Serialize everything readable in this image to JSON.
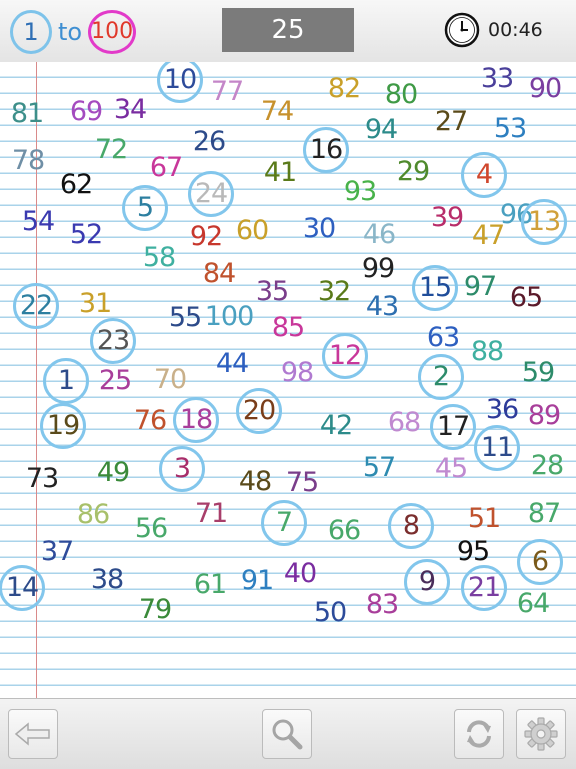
{
  "header": {
    "title_start": "1",
    "title_to": "to",
    "title_end": "100",
    "counter": "25",
    "timer": "00:46"
  },
  "icons": {
    "back": "back-arrow-icon",
    "zoom": "magnifier-icon",
    "refresh": "refresh-icon",
    "settings": "gear-icon",
    "clock": "clock-icon"
  },
  "colors": {
    "found_circle": "#82c6ec",
    "counter_bg": "#7b7b7b"
  },
  "numbers": [
    {
      "v": "10",
      "c": "#2d4b9a",
      "found": true
    },
    {
      "v": "77",
      "c": "#c486c8",
      "found": false
    },
    {
      "v": "82",
      "c": "#c9a02a",
      "found": false
    },
    {
      "v": "80",
      "c": "#3f9a46",
      "found": false
    },
    {
      "v": "33",
      "c": "#4a3f9a",
      "found": false
    },
    {
      "v": "90",
      "c": "#7a3ea0",
      "found": false
    },
    {
      "v": "81",
      "c": "#3d8f8a",
      "found": false
    },
    {
      "v": "69",
      "c": "#a44bbf",
      "found": false
    },
    {
      "v": "34",
      "c": "#7a2da0",
      "found": false
    },
    {
      "v": "74",
      "c": "#c7912d",
      "found": false
    },
    {
      "v": "94",
      "c": "#2c8b8a",
      "found": false
    },
    {
      "v": "27",
      "c": "#5a4a1a",
      "found": false
    },
    {
      "v": "53",
      "c": "#2d7fc0",
      "found": false
    },
    {
      "v": "78",
      "c": "#6f8fa6",
      "found": false
    },
    {
      "v": "72",
      "c": "#48a86a",
      "found": false
    },
    {
      "v": "26",
      "c": "#2d4b8a",
      "found": false
    },
    {
      "v": "16",
      "c": "#222222",
      "found": true
    },
    {
      "v": "67",
      "c": "#c8379a",
      "found": false
    },
    {
      "v": "41",
      "c": "#5a7a1a",
      "found": false
    },
    {
      "v": "29",
      "c": "#4f8a2d",
      "found": false
    },
    {
      "v": "4",
      "c": "#d0472d",
      "found": true
    },
    {
      "v": "62",
      "c": "#111111",
      "found": false
    },
    {
      "v": "93",
      "c": "#48b24a",
      "found": false
    },
    {
      "v": "5",
      "c": "#2d7fa0",
      "found": true
    },
    {
      "v": "24",
      "c": "#b9b9b9",
      "found": true
    },
    {
      "v": "54",
      "c": "#3a3ab0",
      "found": false
    },
    {
      "v": "52",
      "c": "#3a3ab0",
      "found": false
    },
    {
      "v": "92",
      "c": "#c7382d",
      "found": false
    },
    {
      "v": "60",
      "c": "#c9a02a",
      "found": false
    },
    {
      "v": "30",
      "c": "#2d5fc0",
      "found": false
    },
    {
      "v": "46",
      "c": "#8ab6c8",
      "found": false
    },
    {
      "v": "39",
      "c": "#b82d6a",
      "found": false
    },
    {
      "v": "47",
      "c": "#c9a02a",
      "found": false
    },
    {
      "v": "96",
      "c": "#4aa0c0",
      "found": false
    },
    {
      "v": "13",
      "c": "#d0a03a",
      "found": true
    },
    {
      "v": "58",
      "c": "#3fb0a0",
      "found": false
    },
    {
      "v": "84",
      "c": "#c0522d",
      "found": false
    },
    {
      "v": "99",
      "c": "#222222",
      "found": false
    },
    {
      "v": "22",
      "c": "#2d7fa0",
      "found": true
    },
    {
      "v": "31",
      "c": "#c9a02a",
      "found": false
    },
    {
      "v": "35",
      "c": "#7a3e8a",
      "found": false
    },
    {
      "v": "32",
      "c": "#5a7a1a",
      "found": false
    },
    {
      "v": "43",
      "c": "#2d6fb0",
      "found": false
    },
    {
      "v": "15",
      "c": "#1f4d9a",
      "found": true
    },
    {
      "v": "97",
      "c": "#2d8b6a",
      "found": false
    },
    {
      "v": "65",
      "c": "#5a1a2a",
      "found": false
    },
    {
      "v": "55",
      "c": "#2d4b8a",
      "found": false
    },
    {
      "v": "100",
      "c": "#4aa0c0",
      "found": false
    },
    {
      "v": "85",
      "c": "#c8379a",
      "found": false
    },
    {
      "v": "23",
      "c": "#555555",
      "found": true
    },
    {
      "v": "63",
      "c": "#2d5fc0",
      "found": false
    },
    {
      "v": "88",
      "c": "#3fb0a0",
      "found": false
    },
    {
      "v": "44",
      "c": "#2d5fc0",
      "found": false
    },
    {
      "v": "98",
      "c": "#b07ad0",
      "found": false
    },
    {
      "v": "12",
      "c": "#c8379a",
      "found": true
    },
    {
      "v": "1",
      "c": "#2d4b8a",
      "found": true
    },
    {
      "v": "25",
      "c": "#a83e9a",
      "found": false
    },
    {
      "v": "70",
      "c": "#c9b08a",
      "found": false
    },
    {
      "v": "2",
      "c": "#2d8b6a",
      "found": true
    },
    {
      "v": "59",
      "c": "#2d8b6a",
      "found": false
    },
    {
      "v": "19",
      "c": "#5a4a1a",
      "found": true
    },
    {
      "v": "76",
      "c": "#c0522d",
      "found": false
    },
    {
      "v": "18",
      "c": "#a83e9a",
      "found": true
    },
    {
      "v": "20",
      "c": "#7a3e1a",
      "found": true
    },
    {
      "v": "42",
      "c": "#2d8b8a",
      "found": false
    },
    {
      "v": "68",
      "c": "#c08ad0",
      "found": false
    },
    {
      "v": "17",
      "c": "#222222",
      "found": true
    },
    {
      "v": "36",
      "c": "#2d3b9a",
      "found": false
    },
    {
      "v": "89",
      "c": "#a83e9a",
      "found": false
    },
    {
      "v": "11",
      "c": "#2d4b8a",
      "found": true
    },
    {
      "v": "73",
      "c": "#222222",
      "found": false
    },
    {
      "v": "49",
      "c": "#3a8a3a",
      "found": false
    },
    {
      "v": "3",
      "c": "#a82d6a",
      "found": true
    },
    {
      "v": "48",
      "c": "#5a4a1a",
      "found": false
    },
    {
      "v": "75",
      "c": "#7a3e8a",
      "found": false
    },
    {
      "v": "57",
      "c": "#2d8bb0",
      "found": false
    },
    {
      "v": "45",
      "c": "#c08ad0",
      "found": false
    },
    {
      "v": "28",
      "c": "#48a86a",
      "found": false
    },
    {
      "v": "86",
      "c": "#a8c06a",
      "found": false
    },
    {
      "v": "56",
      "c": "#48a86a",
      "found": false
    },
    {
      "v": "71",
      "c": "#a83e6a",
      "found": false
    },
    {
      "v": "7",
      "c": "#48a86a",
      "found": true
    },
    {
      "v": "66",
      "c": "#48a86a",
      "found": false
    },
    {
      "v": "8",
      "c": "#7a2d2d",
      "found": true
    },
    {
      "v": "51",
      "c": "#c0522d",
      "found": false
    },
    {
      "v": "87",
      "c": "#48a86a",
      "found": false
    },
    {
      "v": "37",
      "c": "#2d4b9a",
      "found": false
    },
    {
      "v": "95",
      "c": "#111111",
      "found": false
    },
    {
      "v": "6",
      "c": "#7a5a1a",
      "found": true
    },
    {
      "v": "14",
      "c": "#2d4b8a",
      "found": true
    },
    {
      "v": "38",
      "c": "#2d4b8a",
      "found": false
    },
    {
      "v": "61",
      "c": "#48a86a",
      "found": false
    },
    {
      "v": "91",
      "c": "#2d7fc0",
      "found": false
    },
    {
      "v": "40",
      "c": "#7a2da0",
      "found": false
    },
    {
      "v": "9",
      "c": "#4a2d5a",
      "found": true
    },
    {
      "v": "21",
      "c": "#7a3ea0",
      "found": true
    },
    {
      "v": "64",
      "c": "#48a86a",
      "found": false
    },
    {
      "v": "79",
      "c": "#3a8a3a",
      "found": false
    },
    {
      "v": "50",
      "c": "#2d4b9a",
      "found": false
    },
    {
      "v": "83",
      "c": "#a83e9a",
      "found": false
    }
  ]
}
